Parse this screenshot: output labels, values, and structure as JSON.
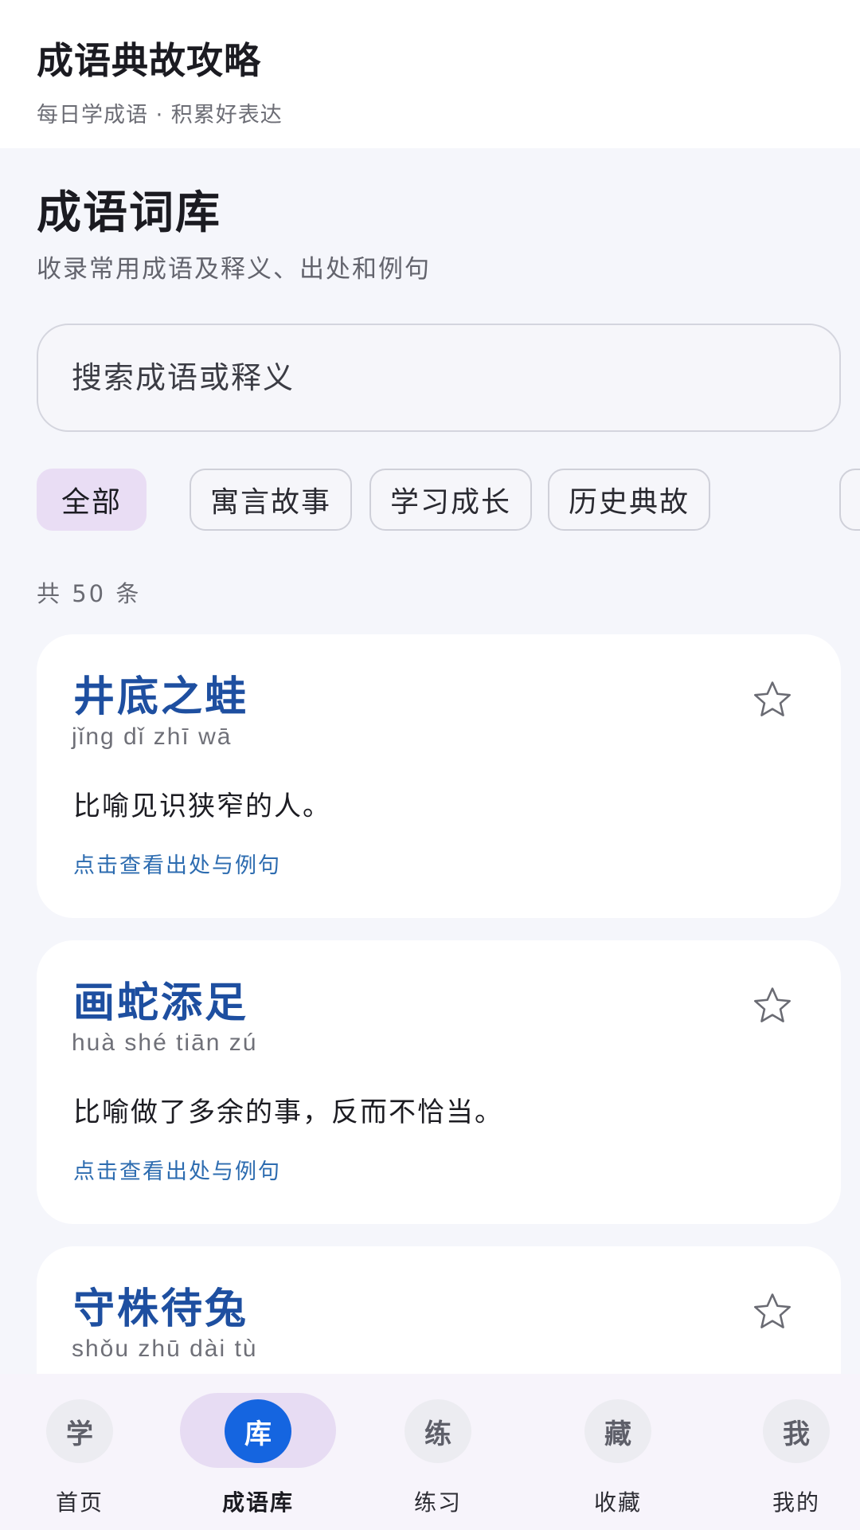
{
  "header": {
    "title": "成语典故攻略",
    "subtitle": "每日学成语 · 积累好表达"
  },
  "library": {
    "title": "成语词库",
    "description": "收录常用成语及释义、出处和例句"
  },
  "search": {
    "placeholder": "搜索成语或释义",
    "value": ""
  },
  "filters": [
    {
      "label": "全部",
      "active": true
    },
    {
      "label": "寓言故事",
      "active": false
    },
    {
      "label": "学习成长",
      "active": false
    },
    {
      "label": "历史典故",
      "active": false
    }
  ],
  "count_label": "共 50 条",
  "cards": [
    {
      "idiom": "井底之蛙",
      "pinyin": "jǐng dǐ zhī wā",
      "meaning": "比喻见识狭窄的人。",
      "link": "点击查看出处与例句",
      "favorited": false
    },
    {
      "idiom": "画蛇添足",
      "pinyin": "huà shé tiān zú",
      "meaning": "比喻做了多余的事，反而不恰当。",
      "link": "点击查看出处与例句",
      "favorited": false
    },
    {
      "idiom": "守株待兔",
      "pinyin": "shǒu zhū dài tù",
      "meaning": "",
      "link": "",
      "favorited": false
    }
  ],
  "bottom_nav": [
    {
      "icon_char": "学",
      "label": "首页",
      "active": false
    },
    {
      "icon_char": "库",
      "label": "成语库",
      "active": true
    },
    {
      "icon_char": "练",
      "label": "练习",
      "active": false
    },
    {
      "icon_char": "藏",
      "label": "收藏",
      "active": false
    },
    {
      "icon_char": "我",
      "label": "我的",
      "active": false
    }
  ],
  "colors": {
    "accent": "#1565e0",
    "idiom_title": "#1e4fa0",
    "link": "#2d6cb0",
    "active_chip": "#e9ddf4",
    "background": "#f5f6fb"
  },
  "icons": {
    "favorite": "star-outline-icon"
  }
}
